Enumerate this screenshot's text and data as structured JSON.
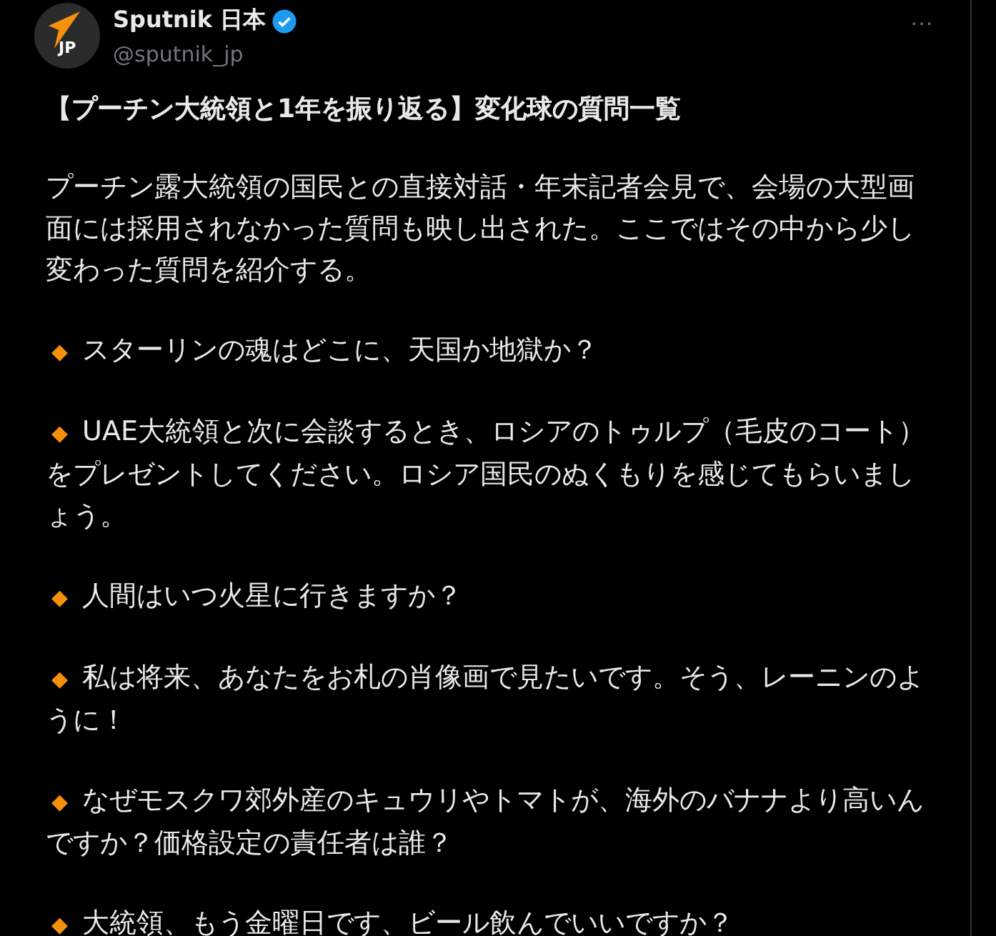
{
  "author": {
    "avatar_label": "JP",
    "name": "Sputnik 日本",
    "verified": true,
    "handle": "@sputnik_jp",
    "more": "···"
  },
  "post": {
    "title": "【プーチン大統領と1年を振り返る】変化球の質問一覧",
    "intro": "プーチン露大統領の国民との直接対話・年末記者会見で、会場の大型画面には採用されなかった質問も映し出された。ここではその中から少し変わった質問を紹介する。",
    "items": [
      {
        "marker": "◆",
        "text": "スターリンの魂はどこに、天国か地獄か？"
      },
      {
        "marker": "◆",
        "text": "UAE大統領と次に会談するとき、ロシアのトゥルプ（毛皮のコート）をプレゼントしてください。ロシア国民のぬくもりを感じてもらいましょう。"
      },
      {
        "marker": "◆",
        "text": "人間はいつ火星に行きますか？"
      },
      {
        "marker": "◆",
        "text": "私は将来、あなたをお札の肖像画で見たいです。そう、レーニンのように！"
      },
      {
        "marker": "◆",
        "text": "なぜモスクワ郊外産のキュウリやトマトが、海外のバナナより高いんですか？価格設定の責任者は誰？"
      },
      {
        "marker": "◆",
        "text": "大統領、もう金曜日です、ビール飲んでいいですか？"
      }
    ]
  }
}
